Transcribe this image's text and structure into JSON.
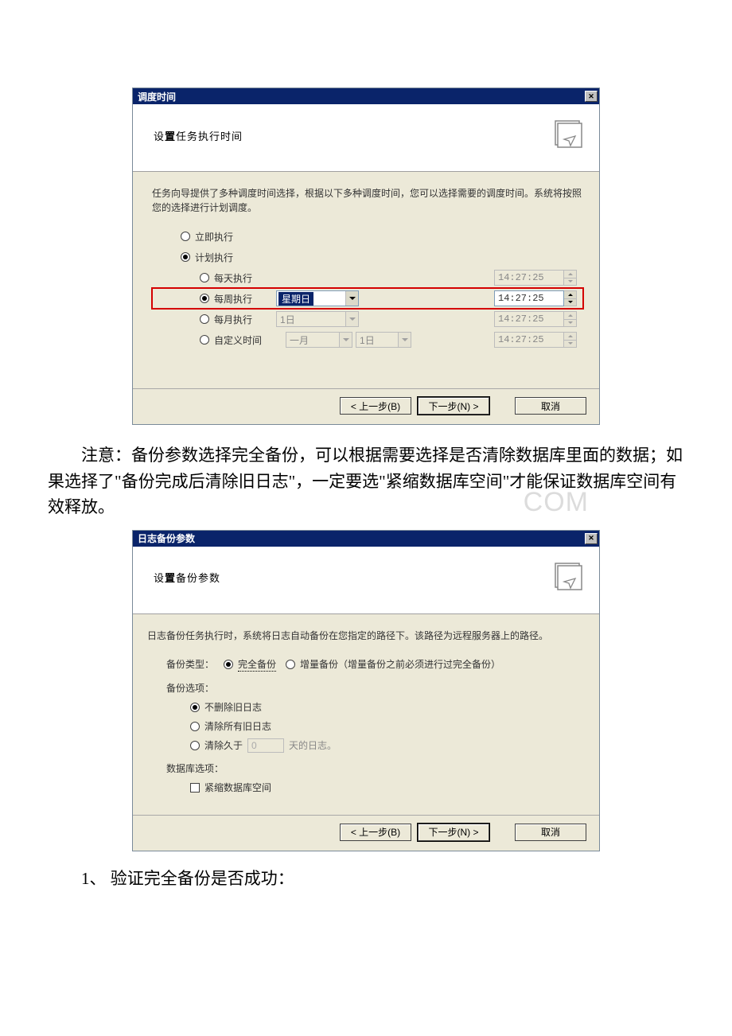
{
  "dialog1": {
    "title": "调度时间",
    "header": "设置任务执行时间",
    "desc": "任务向导提供了多种调度时间选择，根据以下多种调度时间，您可以选择需要的调度时间。系统将按照您的选择进行计划调度。",
    "radios": {
      "immediate": "立即执行",
      "scheduled": "计划执行",
      "daily": "每天执行",
      "weekly": "每周执行",
      "monthly": "每月执行",
      "custom": "自定义时间"
    },
    "weekday": "星期日",
    "monthday": "1日",
    "month": "一月",
    "customday": "1日",
    "time": "14:27:25"
  },
  "paragraph": "注意：备份参数选择完全备份，可以根据需要选择是否清除数据库里面的数据；如果选择了\"备份完成后清除旧日志\"，一定要选\"紧缩数据库空间\"才能保证数据库空间有效释放。",
  "watermark": "COM",
  "dialog2": {
    "title": "日志备份参数",
    "header": "设置备份参数",
    "desc": "日志备份任务执行时，系统将日志自动备份在您指定的路径下。该路径为远程服务器上的路径。",
    "type_label": "备份类型：",
    "full": "完全备份",
    "inc": "增量备份（增量备份之前必须进行过完全备份）",
    "opt_label": "备份选项：",
    "opt1": "不删除旧日志",
    "opt2": "清除所有旧日志",
    "opt3_pre": "清除久于",
    "opt3_val": "0",
    "opt3_post": "天的日志。",
    "db_label": "数据库选项：",
    "compact": "紧缩数据库空间"
  },
  "buttons": {
    "back": "< 上一步(B)",
    "next": "下一步(N) >",
    "cancel": "取消"
  },
  "listitem": "1、 验证完全备份是否成功："
}
